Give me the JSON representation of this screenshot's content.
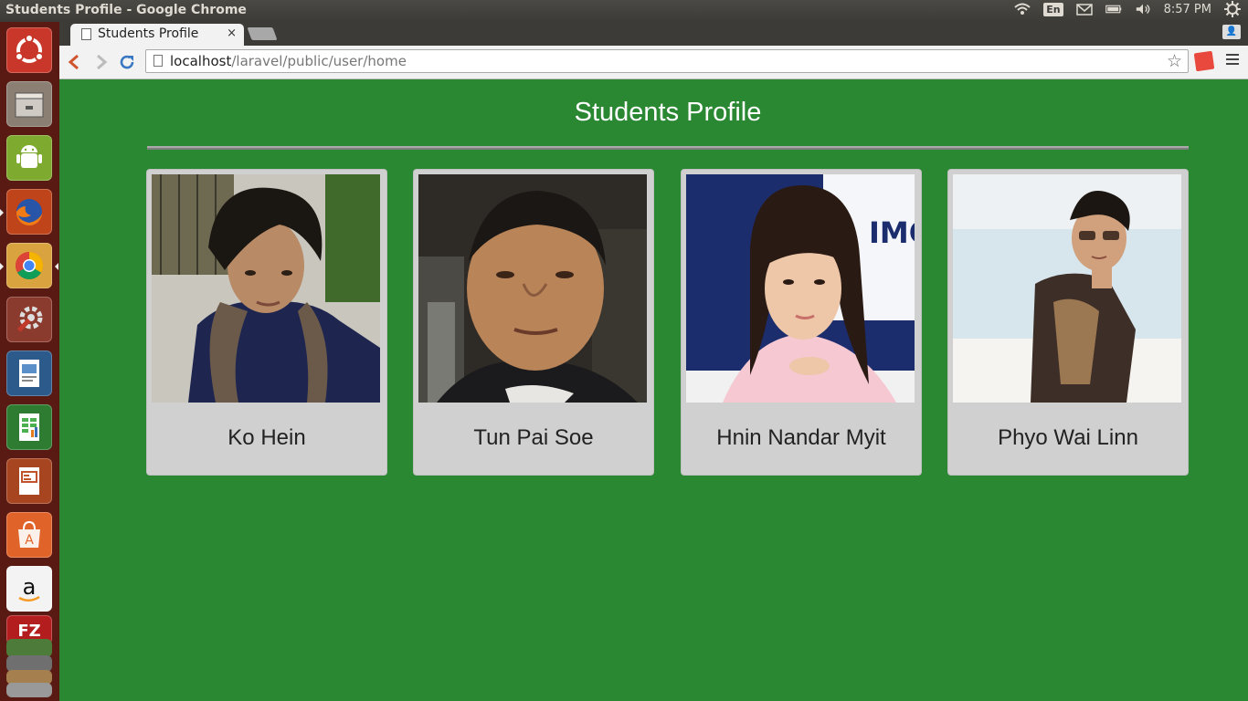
{
  "window": {
    "title": "Students Profile - Google Chrome"
  },
  "panel": {
    "lang": "En",
    "time": "8:57 PM"
  },
  "launcher": {
    "items": [
      "ubuntu-dash-icon",
      "files-icon",
      "android-icon",
      "firefox-icon",
      "chrome-icon",
      "system-settings-icon",
      "writer-icon",
      "calc-icon",
      "impress-icon",
      "software-center-icon",
      "amazon-icon",
      "filezilla-icon"
    ]
  },
  "browser": {
    "tab_label": "Students Profile",
    "tab_close": "×",
    "url_host": "localhost",
    "url_path": "/laravel/public/user/home",
    "profile_label": "👤"
  },
  "page": {
    "title": "Students Profile",
    "students": [
      {
        "name": "Ko Hein"
      },
      {
        "name": "Tun Pai Soe"
      },
      {
        "name": "Hnin Nandar Myit"
      },
      {
        "name": "Phyo Wai Linn"
      }
    ]
  },
  "colors": {
    "page_bg": "#2a8732",
    "card_bg": "#d0d0d0",
    "launcher_bg": "#5a1a14"
  }
}
